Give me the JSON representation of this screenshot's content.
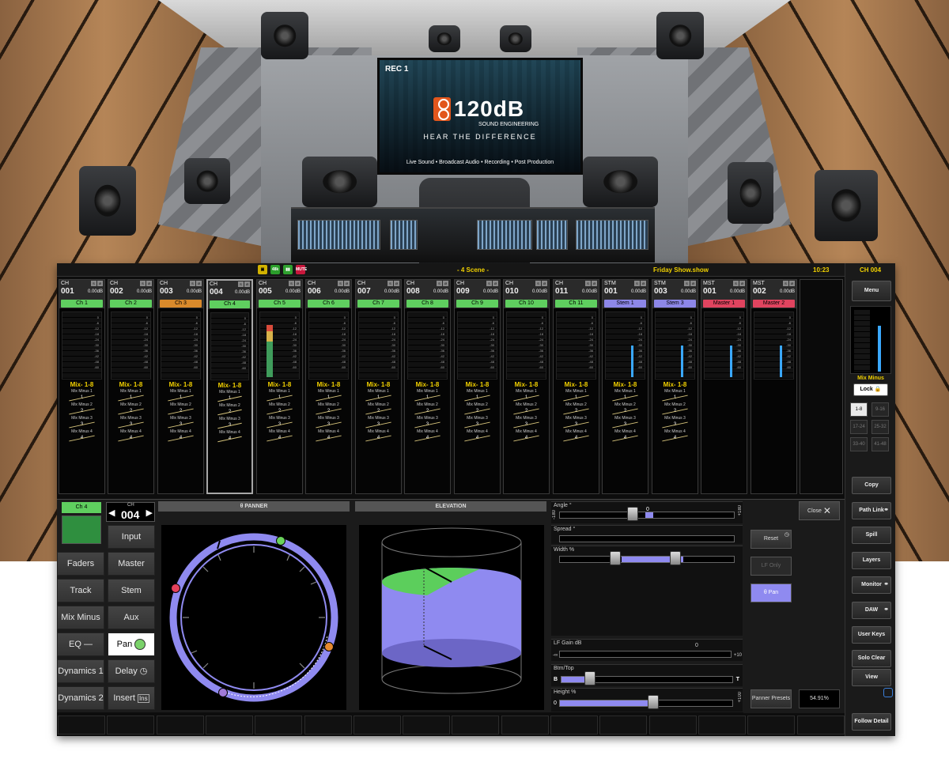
{
  "tv": {
    "rec": "REC 1",
    "brand": "120dB",
    "subtitle": "SOUND ENGINEERING",
    "tagline": "HEAR THE DIFFERENCE",
    "footer": "Live Sound • Broadcast Audio • Recording • Post Production"
  },
  "statusbar": {
    "scene": "- 4  Scene -",
    "show": "Friday Show.show",
    "clock": "10:23",
    "channel": "CH  004",
    "icons": [
      "save-icon",
      "48k-icon",
      "battery-icon",
      "mute-icon"
    ],
    "icon_labels": [
      "",
      "48k",
      "",
      "MUTE"
    ]
  },
  "strips": [
    {
      "type": "CH",
      "num": "001",
      "db": "0.00dB",
      "label": "Ch 1",
      "color": "#5fcf5f",
      "level": 0,
      "mix_head": "Mix- 1-8"
    },
    {
      "type": "CH",
      "num": "002",
      "db": "0.00dB",
      "label": "Ch 2",
      "color": "#5fcf5f",
      "level": 0,
      "mix_head": "Mix- 1-8"
    },
    {
      "type": "CH",
      "num": "003",
      "db": "0.00dB",
      "label": "Ch 3",
      "color": "#d98a2b",
      "level": 0,
      "mix_head": "Mix- 1-8"
    },
    {
      "type": "CH",
      "num": "004",
      "db": "0.00dB",
      "label": "Ch 4",
      "color": "#5fcf5f",
      "level": 0,
      "mix_head": "Mix- 1-8",
      "selected": true
    },
    {
      "type": "CH",
      "num": "005",
      "db": "0.00dB",
      "label": "Ch 5",
      "color": "#5fcf5f",
      "level": 0.82,
      "mix_head": "Mix- 1-8"
    },
    {
      "type": "CH",
      "num": "006",
      "db": "0.00dB",
      "label": "Ch 6",
      "color": "#5fcf5f",
      "level": 0,
      "mix_head": "Mix- 1-8"
    },
    {
      "type": "CH",
      "num": "007",
      "db": "0.00dB",
      "label": "Ch 7",
      "color": "#5fcf5f",
      "level": 0,
      "mix_head": "Mix- 1-8"
    },
    {
      "type": "CH",
      "num": "008",
      "db": "0.00dB",
      "label": "Ch 8",
      "color": "#5fcf5f",
      "level": 0,
      "mix_head": "Mix- 1-8"
    },
    {
      "type": "CH",
      "num": "009",
      "db": "0.00dB",
      "label": "Ch 9",
      "color": "#5fcf5f",
      "level": 0,
      "mix_head": "Mix- 1-8"
    },
    {
      "type": "CH",
      "num": "010",
      "db": "0.00dB",
      "label": "Ch 10",
      "color": "#5fcf5f",
      "level": 0,
      "mix_head": "Mix- 1-8"
    },
    {
      "type": "CH",
      "num": "011",
      "db": "0.00dB",
      "label": "Ch 11",
      "color": "#5fcf5f",
      "level": 0,
      "mix_head": "Mix- 1-8"
    },
    {
      "type": "STM",
      "num": "001",
      "db": "0.00dB",
      "label": "Stem 1",
      "color": "#8d87e8",
      "level": 0,
      "mix_head": "Mix- 1-8"
    },
    {
      "type": "STM",
      "num": "003",
      "db": "0.00dB",
      "label": "Stem 3",
      "color": "#8d87e8",
      "level": 0,
      "mix_head": "Mix- 1-8"
    },
    {
      "type": "MST",
      "num": "001",
      "db": "0.00dB",
      "label": "Master 1",
      "color": "#e0445f",
      "level": 0,
      "mix_head": ""
    },
    {
      "type": "MST",
      "num": "002",
      "db": "0.00dB",
      "label": "Master 2",
      "color": "#e0445f",
      "level": 0,
      "mix_head": ""
    }
  ],
  "mix_minus_labels": [
    "Mix Minus 1",
    "Mix Minus 2",
    "Mix Minus 3",
    "Mix Minus 4"
  ],
  "mix_minus_values": [
    "1",
    "2",
    "3",
    "4"
  ],
  "meter_ticks": [
    "0",
    "-6",
    "-12",
    "-18",
    "-24",
    "-30",
    "-36",
    "-42",
    "-48",
    "-60"
  ],
  "rightcol": {
    "menu": "Menu",
    "mix_minus": "Mix Minus",
    "lock": "Lock",
    "banks": [
      "1-8",
      "9-16",
      "17-24",
      "25-32",
      "33-40",
      "41-48"
    ],
    "copy": "Copy",
    "path_link": "Path Link",
    "spill": "Spill",
    "layers": "Layers",
    "monitor": "Monitor",
    "daw": "DAW",
    "user_keys": "User Keys",
    "solo_clear": "Solo Clear",
    "view": "View",
    "follow_detail": "Follow Detail"
  },
  "left": {
    "ch_label": "Ch 4",
    "ch_type": "CH",
    "ch_num": "004",
    "input": "Input",
    "faders": "Faders",
    "master": "Master",
    "track": "Track",
    "stem": "Stem",
    "mix_minus": "Mix Minus",
    "aux": "Aux",
    "eq": "EQ",
    "pan": "Pan",
    "dynamics1": "Dynamics 1",
    "delay": "Delay",
    "dynamics2": "Dynamics 2",
    "insert": "Insert",
    "ins_icon": "Ins"
  },
  "panner": {
    "title": "θ PANNER",
    "elevation_title": "ELEVATION",
    "angle_label": "Angle  °",
    "angle_value": "0",
    "angle_min": "-180",
    "angle_max": "+180",
    "spread_label": "Spread  °",
    "width_label": "Width  %",
    "lf_gain_label": "LF Gain  dB",
    "lf_gain_value": "0",
    "lf_gain_min": "-∞",
    "lf_gain_max": "+10",
    "btm_top_label": "Btm/Top",
    "btm": "B",
    "top": "T",
    "height_label": "Height  %",
    "height_min": "0",
    "height_max": "+100",
    "reset": "Reset",
    "lf_only": "LF Only",
    "theta_pan": "θ Pan",
    "close": "Close",
    "presets": "Panner Presets",
    "percent": "54.91%",
    "accent": "#8f8af0"
  }
}
